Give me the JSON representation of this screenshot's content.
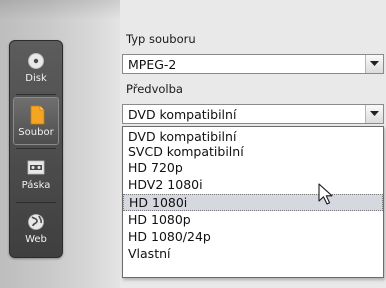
{
  "sidebar": {
    "tabs": [
      {
        "label": "Disk",
        "icon": "disc-icon",
        "active": false
      },
      {
        "label": "Soubor",
        "icon": "file-icon",
        "active": true
      },
      {
        "label": "Páska",
        "icon": "tape-icon",
        "active": false
      },
      {
        "label": "Web",
        "icon": "globe-icon",
        "active": false
      }
    ]
  },
  "file_type": {
    "label": "Typ souboru",
    "value": "MPEG-2"
  },
  "preset": {
    "label": "Předvolba",
    "value": "DVD kompatibilní",
    "options": [
      "DVD kompatibilní",
      "SVCD kompatibilní",
      "HD 720p",
      "HDV2 1080i",
      "HD 1080i",
      "HD 1080p",
      "HD 1080/24p",
      "Vlastní"
    ],
    "highlighted": "HD 1080i"
  },
  "colors": {
    "tabbar": "#4a4a4a",
    "active_icon": "#f0a020",
    "highlight": "#d6d8e0"
  }
}
